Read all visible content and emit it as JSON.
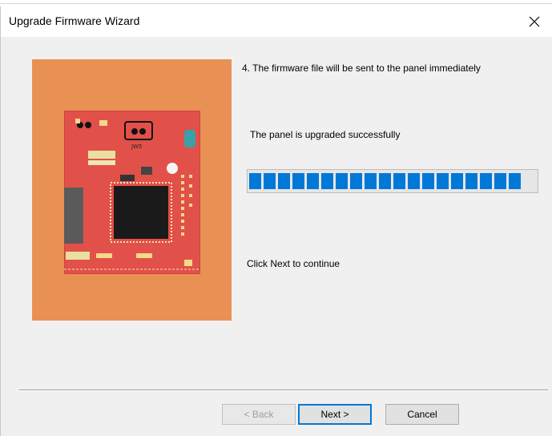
{
  "window": {
    "title": "Upgrade Firmware Wizard"
  },
  "content": {
    "step_text": "4. The firmware file will be sent to the panel immediately",
    "status_text": "The panel is upgraded successfully",
    "progress_percent": 100,
    "progress_segments": 19,
    "hint_text": "Click  Next  to continue"
  },
  "image": {
    "background_color": "#e99154",
    "board_color": "#e2504a",
    "board_label": "JW5"
  },
  "buttons": {
    "back_label": "< Back",
    "next_label": "Next >",
    "cancel_label": "Cancel"
  },
  "colors": {
    "progress": "#0078d7",
    "focus_border": "#0078d7"
  }
}
